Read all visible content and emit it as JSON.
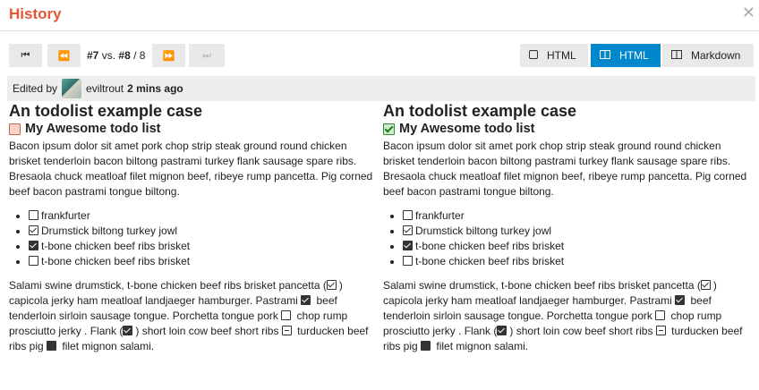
{
  "modal": {
    "title": "History"
  },
  "nav": {
    "revision_current": "#7",
    "vs": "vs.",
    "revision_other": "#8",
    "revision_total": "/ 8"
  },
  "modes": [
    {
      "label": "HTML",
      "icon": "square-icon",
      "active": false
    },
    {
      "label": "HTML",
      "icon": "columns-icon",
      "active": true
    },
    {
      "label": "Markdown",
      "icon": "columns-icon",
      "active": false
    }
  ],
  "edit": {
    "edited_by": "Edited by",
    "user": "eviltrout",
    "time": "2 mins ago"
  },
  "post": {
    "heading": "An todolist example case",
    "subheading": "My Awesome todo list",
    "intro": "Bacon ipsum dolor sit amet pork chop strip steak ground round chicken brisket tenderloin bacon biltong pastrami turkey flank sausage spare ribs. Bresaola chuck meatloaf filet mignon beef, ribeye rump pancetta. Pig corned beef bacon pastrami tongue biltong.",
    "items": [
      {
        "text": "frankfurter"
      },
      {
        "text": "Drumstick biltong turkey jowl"
      },
      {
        "text": "t-bone chicken beef ribs brisket"
      },
      {
        "text": "t-bone chicken beef ribs brisket"
      }
    ],
    "para": {
      "s1": "Salami swine drumstick, t-bone chicken beef ribs brisket pancetta (",
      "s2": ") capicola jerky ham meatloaf landjaeger hamburger. Pastrami ",
      "s3": " beef tenderloin sirloin sausage tongue. Porchetta tongue pork ",
      "s4": " chop rump prosciutto jerky . Flank (",
      "s5": ") short loin cow beef short ribs ",
      "s6": " turducken beef ribs pig ",
      "s7": " filet mignon salami."
    }
  }
}
